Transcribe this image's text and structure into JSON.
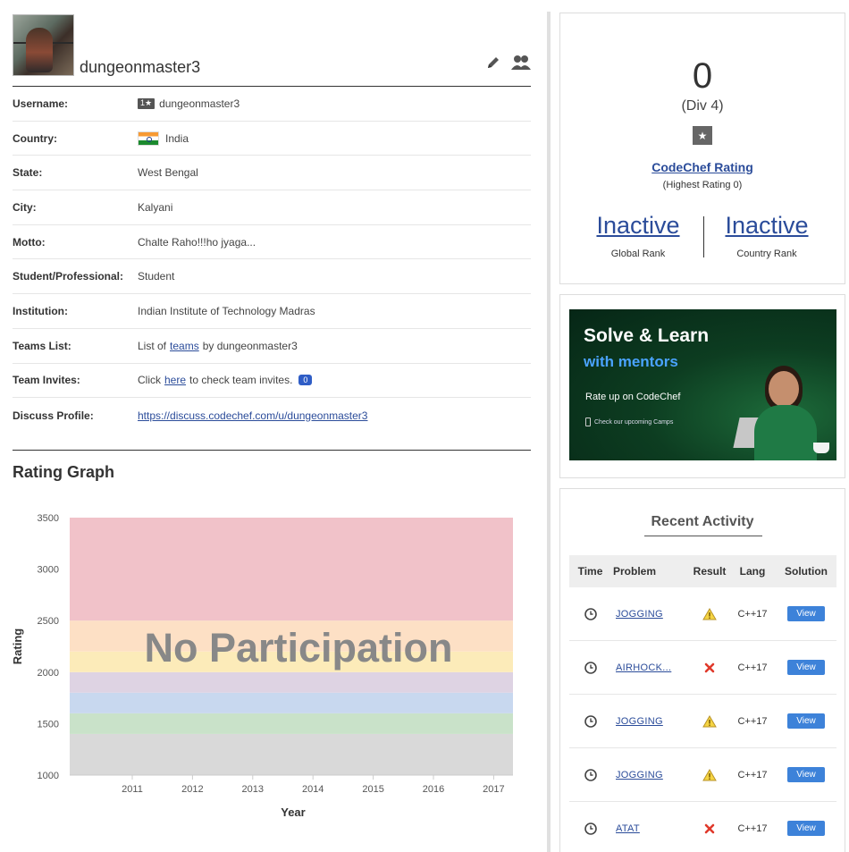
{
  "profile": {
    "display_name": "dungeonmaster3",
    "colors": {
      "divider": "#333333",
      "link": "#2b4c9a"
    },
    "rows": [
      {
        "label": "Username:",
        "value": "dungeonmaster3",
        "badge": "1★"
      },
      {
        "label": "Country:",
        "value": "India"
      },
      {
        "label": "State:",
        "value": "West Bengal"
      },
      {
        "label": "City:",
        "value": "Kalyani"
      },
      {
        "label": "Motto:",
        "value": "Chalte Raho!!!ho jyaga..."
      },
      {
        "label": "Student/Professional:",
        "value": "Student"
      },
      {
        "label": "Institution:",
        "value": "Indian Institute of Technology Madras"
      },
      {
        "label": "Teams List:",
        "pre": "List of",
        "link": "teams",
        "post": "by dungeonmaster3"
      },
      {
        "label": "Team Invites:",
        "pre": "Click",
        "link": "here",
        "post": "to check team invites.",
        "count": "0"
      },
      {
        "label": "Discuss Profile:",
        "link": "https://discuss.codechef.com/u/dungeonmaster3"
      }
    ],
    "icons": [
      "edit-icon",
      "friends-icon"
    ]
  },
  "rating_graph": {
    "heading": "Rating Graph"
  },
  "chart_data": {
    "type": "area",
    "title": "",
    "overlay_text": "No Participation",
    "xlabel": "Year",
    "ylabel": "Rating",
    "x_ticks": [
      "2011",
      "2012",
      "2013",
      "2014",
      "2015",
      "2016",
      "2017"
    ],
    "y_ticks": [
      "1000",
      "1500",
      "2000",
      "2500",
      "3000",
      "3500"
    ],
    "ylim": [
      1000,
      3500
    ],
    "series": [],
    "bands": [
      {
        "from": 1000,
        "to": 1400,
        "color": "#d9d9d9"
      },
      {
        "from": 1400,
        "to": 1600,
        "color": "#c9e2c9"
      },
      {
        "from": 1600,
        "to": 1800,
        "color": "#c8d8ef"
      },
      {
        "from": 1800,
        "to": 2000,
        "color": "#ded3e3"
      },
      {
        "from": 2000,
        "to": 2200,
        "color": "#fcebb9"
      },
      {
        "from": 2200,
        "to": 2500,
        "color": "#fde0c5"
      },
      {
        "from": 2500,
        "to": 3500,
        "color": "#f1c2c9"
      }
    ]
  },
  "rating_card": {
    "rating": "0",
    "division": "(Div 4)",
    "star": "★",
    "rating_link": "CodeChef Rating",
    "highest": "(Highest Rating 0)",
    "global_rank": "Inactive",
    "global_label": "Global Rank",
    "country_rank": "Inactive",
    "country_label": "Country Rank"
  },
  "banner": {
    "line1": "Solve & Learn",
    "line2": "with mentors",
    "line3": "Rate up on CodeChef",
    "line4": "Check our upcoming Camps",
    "colors": {
      "accent": "#4aa3ff",
      "bg": "#0d3d21"
    }
  },
  "activity": {
    "title": "Recent Activity",
    "headers": {
      "time": "Time",
      "problem": "Problem",
      "result": "Result",
      "lang": "Lang",
      "solution": "Solution"
    },
    "rows": [
      {
        "problem": "JOGGING",
        "result": "warning-icon",
        "lang": "C++17",
        "action": "View"
      },
      {
        "problem": "AIRHOCK...",
        "result": "cross-icon",
        "lang": "C++17",
        "action": "View"
      },
      {
        "problem": "JOGGING",
        "result": "warning-icon",
        "lang": "C++17",
        "action": "View"
      },
      {
        "problem": "JOGGING",
        "result": "warning-icon",
        "lang": "C++17",
        "action": "View"
      },
      {
        "problem": "ATAT",
        "result": "cross-icon",
        "lang": "C++17",
        "action": "View"
      }
    ]
  }
}
